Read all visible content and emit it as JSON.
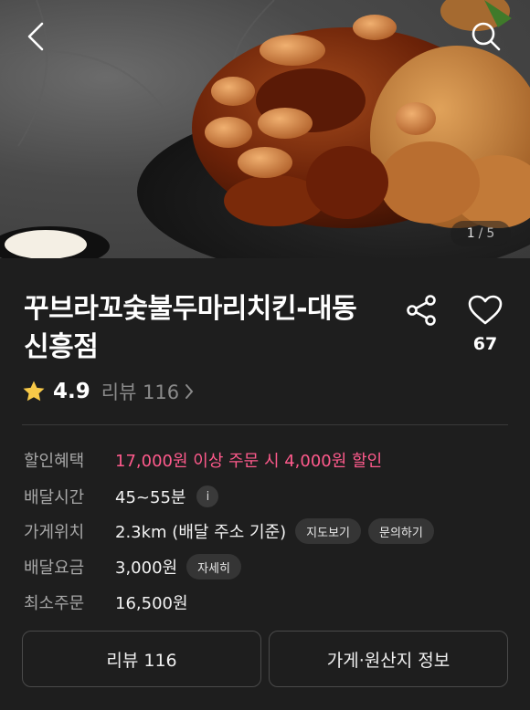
{
  "hero": {
    "page_current": "1",
    "page_separator": "/",
    "page_total": "5"
  },
  "store": {
    "name": "꾸브라꼬숯불두마리치킨-대동신흥점",
    "like_count": "67",
    "rating": "4.9",
    "review_link_label": "리뷰 116"
  },
  "info": {
    "discount": {
      "label": "할인혜택",
      "value": "17,000원 이상 주문 시 4,000원 할인"
    },
    "delivery_time": {
      "label": "배달시간",
      "value": "45~55분",
      "info_icon": "i"
    },
    "location": {
      "label": "가게위치",
      "value": "2.3km (배달 주소 기준)",
      "map_chip": "지도보기",
      "inquiry_chip": "문의하기"
    },
    "delivery_fee": {
      "label": "배달요금",
      "value": "3,000원",
      "detail_chip": "자세히"
    },
    "min_order": {
      "label": "최소주문",
      "value": "16,500원"
    }
  },
  "buttons": {
    "reviews": "리뷰 116",
    "store_info": "가게·원산지 정보"
  },
  "colors": {
    "background": "#1e1e1e",
    "accent_pink": "#ff5a8c",
    "star": "#f7c948",
    "muted": "#8a8a8a"
  },
  "icons": [
    "back-arrow-icon",
    "search-icon",
    "share-icon",
    "heart-icon",
    "star-icon",
    "chevron-right-icon",
    "info-icon"
  ]
}
